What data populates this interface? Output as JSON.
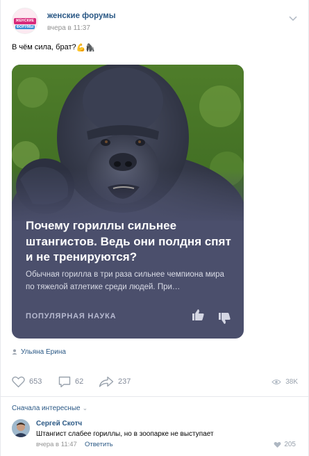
{
  "post": {
    "group_name": "женские форумы",
    "time": "вчера в 11:37",
    "avatar_label": "ЖЕНСКИЕ ФОРУМЫ",
    "text": "В чём сила, брат?",
    "emojis": [
      "💪",
      "🦍"
    ]
  },
  "card": {
    "title": "Почему гориллы сильнее штангистов. Ведь они полдня спят и не тренируются?",
    "description": "Обычная горилла в три раза сильнее чемпиона мира по тяжелой атлетике среди людей. При…",
    "source": "ПОПУЛЯРНАЯ НАУКА"
  },
  "author": "Ульяна Ерина",
  "actions": {
    "likes": "653",
    "comments": "62",
    "shares": "237",
    "views": "38K"
  },
  "comments_sort": "Сначала интересные",
  "comment": {
    "author": "Сергей Скотч",
    "text": "Штангист слабее гориллы, но в зоопарке не выступает",
    "time": "вчера в 11:47",
    "reply_label": "Ответить",
    "likes": "205"
  },
  "colors": {
    "link": "#2a5885",
    "card_bg": "#4b4f6c",
    "muted": "#828a99"
  },
  "icons": [
    "more-icon",
    "like-icon",
    "dislike-icon",
    "heart-icon",
    "comment-icon",
    "share-icon",
    "eye-icon",
    "user-icon",
    "chevron-down-icon"
  ]
}
